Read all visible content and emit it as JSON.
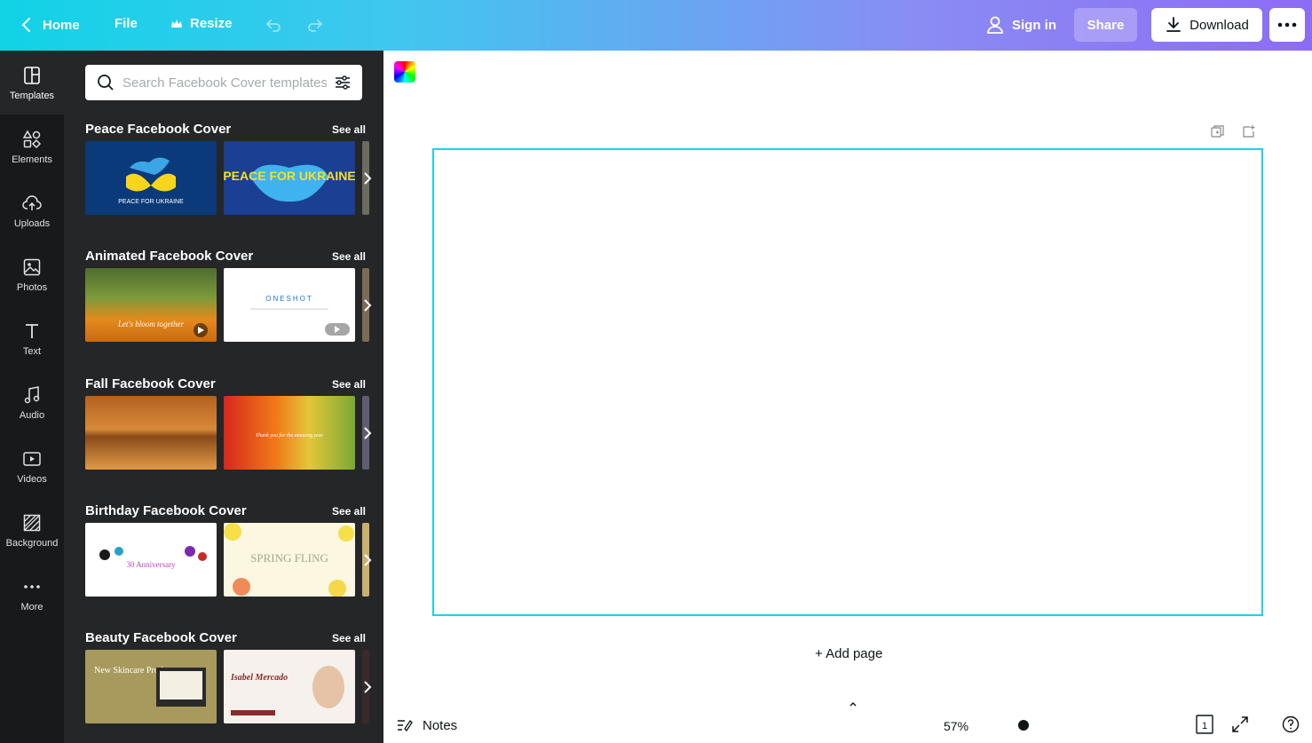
{
  "topbar": {
    "home": "Home",
    "file": "File",
    "resize": "Resize",
    "sign_in": "Sign in",
    "share": "Share",
    "download": "Download"
  },
  "rail": {
    "items": [
      {
        "label": "Templates",
        "icon": "templates-icon"
      },
      {
        "label": "Elements",
        "icon": "elements-icon"
      },
      {
        "label": "Uploads",
        "icon": "upload-cloud-icon"
      },
      {
        "label": "Photos",
        "icon": "photo-icon"
      },
      {
        "label": "Text",
        "icon": "text-icon"
      },
      {
        "label": "Audio",
        "icon": "music-icon"
      },
      {
        "label": "Videos",
        "icon": "video-icon"
      },
      {
        "label": "Background",
        "icon": "background-icon"
      },
      {
        "label": "More",
        "icon": "more-dots-icon"
      }
    ]
  },
  "search": {
    "placeholder": "Search Facebook Cover templates"
  },
  "sections": [
    {
      "title": "Peace Facebook Cover",
      "see_all": "See all",
      "thumbs": [
        {
          "text": "PEACE FOR UKRAINE"
        },
        {
          "text": "PEACE FOR UKRAINE"
        }
      ]
    },
    {
      "title": "Animated Facebook Cover",
      "see_all": "See all",
      "thumbs": [
        {
          "text": "Let's bloom together"
        },
        {
          "text": "ONESHOT"
        }
      ]
    },
    {
      "title": "Fall Facebook Cover",
      "see_all": "See all",
      "thumbs": [
        {
          "text": ""
        },
        {
          "text": "Thank you for the amazing year"
        }
      ]
    },
    {
      "title": "Birthday Facebook Cover",
      "see_all": "See all",
      "thumbs": [
        {
          "text": "30 Anniversary"
        },
        {
          "text": "SPRING FLING"
        }
      ]
    },
    {
      "title": "Beauty Facebook Cover",
      "see_all": "See all",
      "thumbs": [
        {
          "text": "New Skincare Product"
        },
        {
          "text": "Isabel Mercado"
        }
      ]
    }
  ],
  "canvas": {
    "add_page": "+ Add page",
    "page_border_color": "#13d5ea"
  },
  "bottombar": {
    "notes": "Notes",
    "zoom": "57%",
    "page_count": "1"
  }
}
